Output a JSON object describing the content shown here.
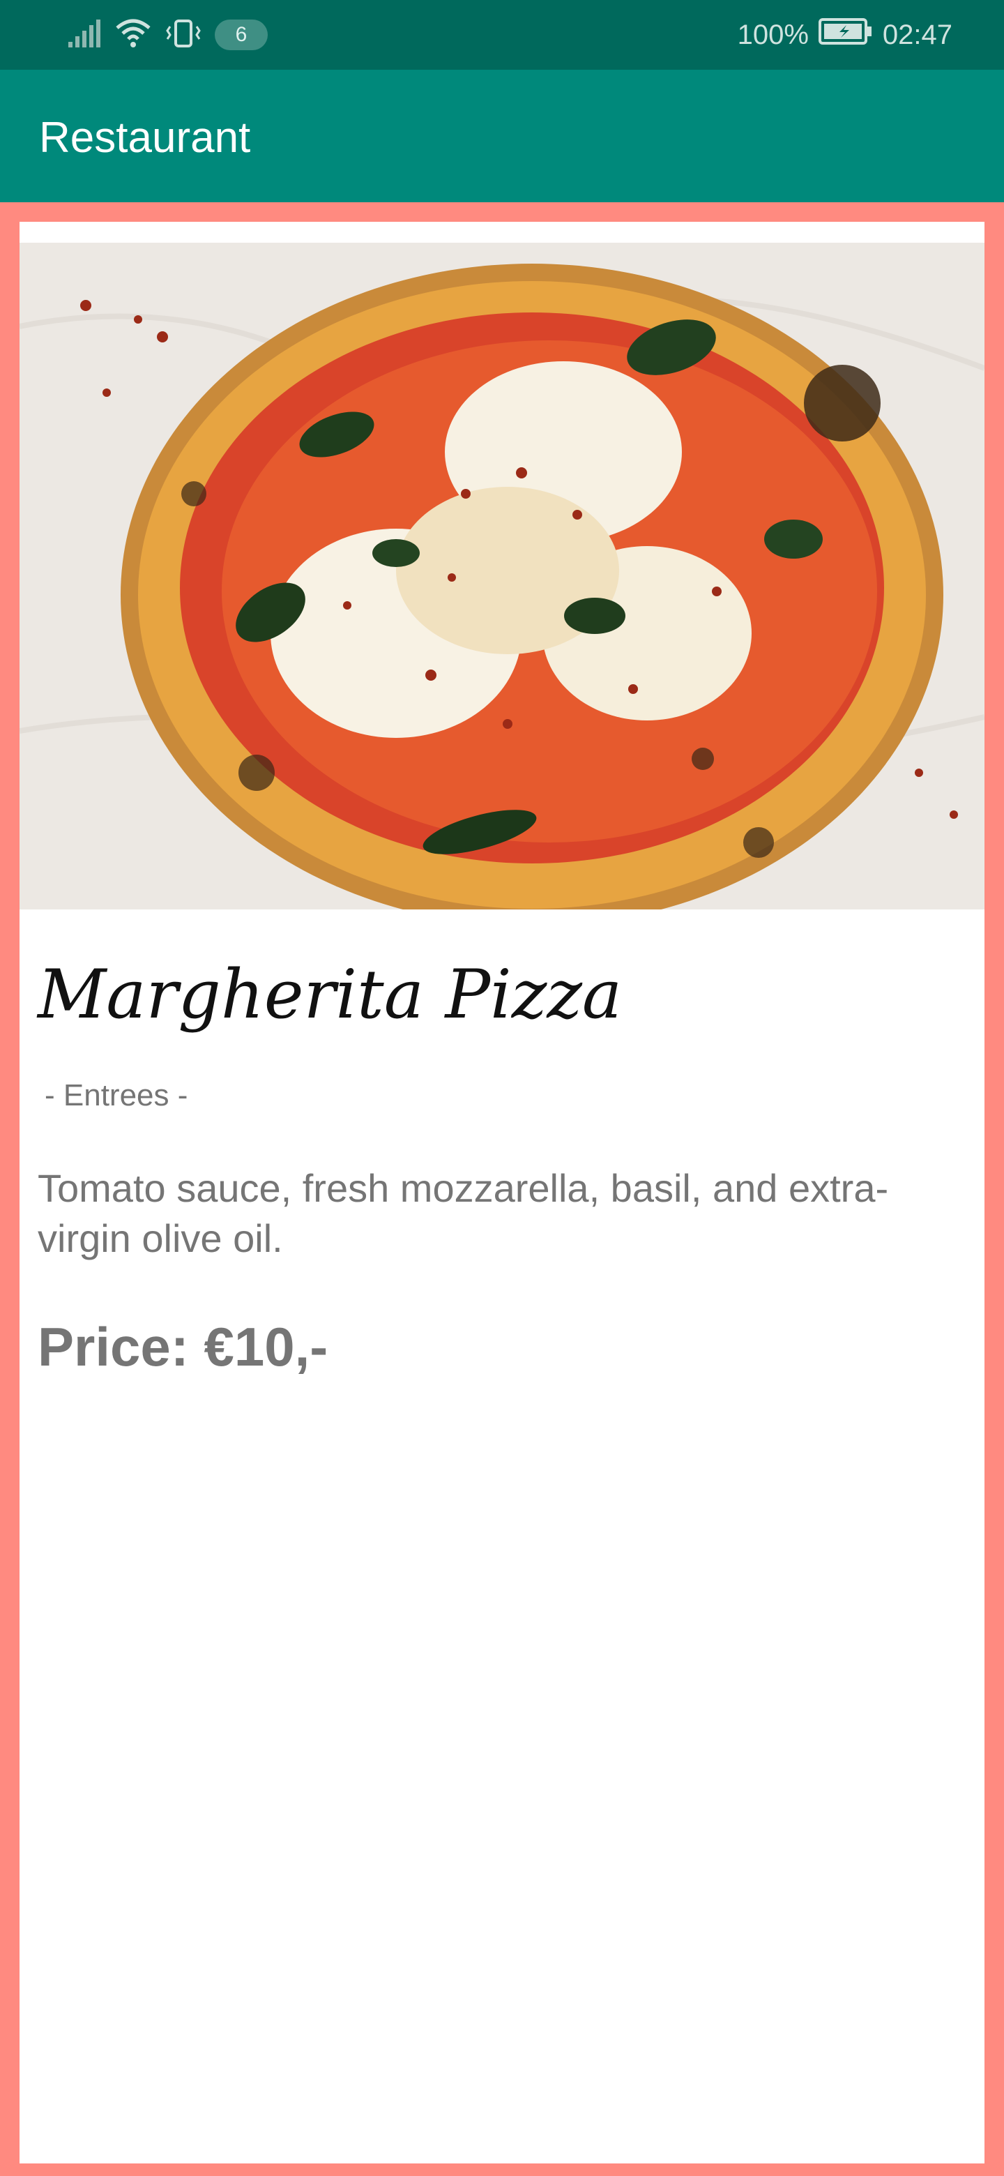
{
  "status_bar": {
    "notification_count": "6",
    "battery": "100%",
    "time": "02:47",
    "icons": [
      "signal-icon",
      "wifi-icon",
      "vibrate-icon",
      "battery-charging-icon"
    ]
  },
  "app_bar": {
    "title": "Restaurant"
  },
  "menu_item": {
    "name": "Margherita Pizza",
    "category": "- Entrees -",
    "description": "Tomato sauce, fresh mozzarella, basil, and extra-virgin olive oil.",
    "price": "Price: €10,-",
    "image": "margherita-pizza-photo"
  },
  "colors": {
    "status_bar": "#00695c",
    "app_bar": "#00897b",
    "background": "#ff8a80",
    "card": "#ffffff",
    "secondary_text": "#757575"
  }
}
